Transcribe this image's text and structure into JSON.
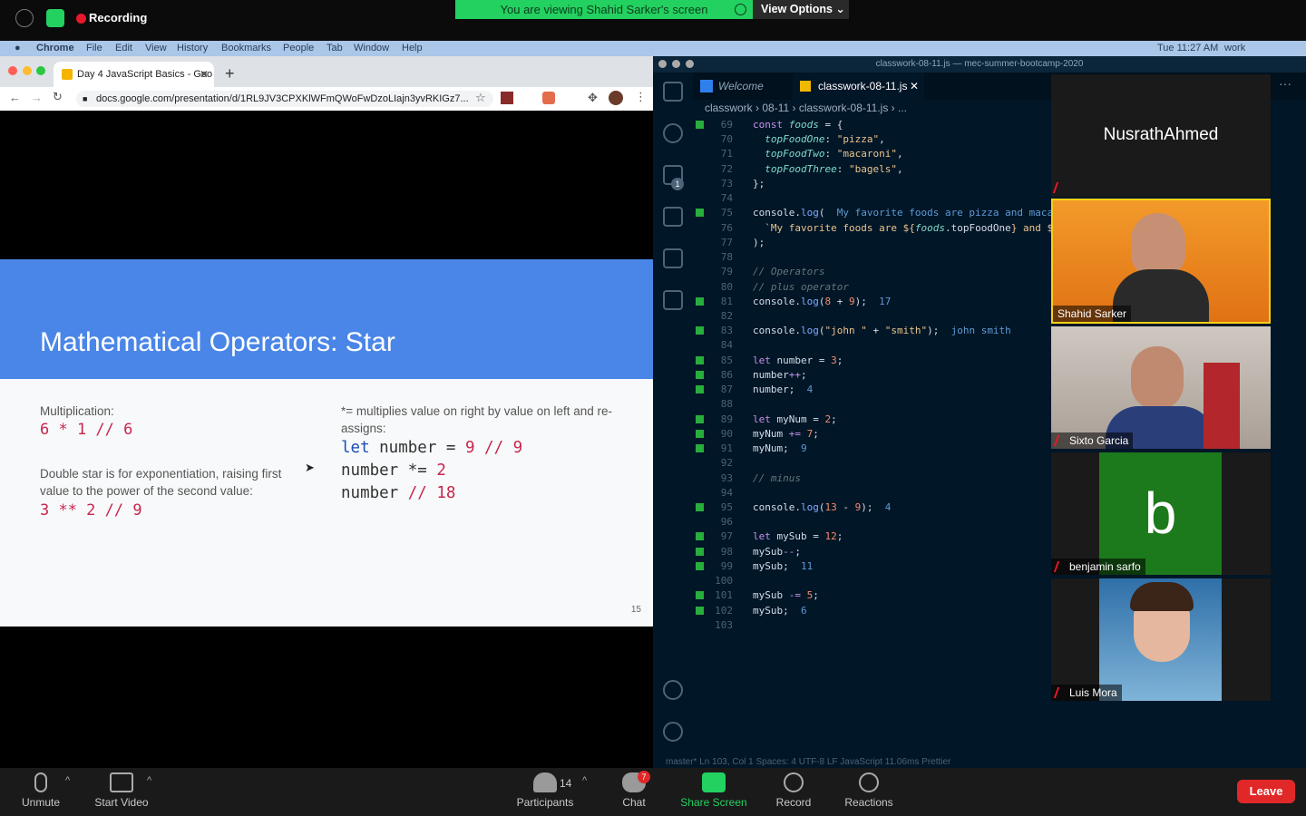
{
  "zoom_top": {
    "recording_label": "Recording",
    "banner": "You are viewing Shahid Sarker's screen",
    "view_options": "View Options"
  },
  "mac_menu": {
    "app": "Chrome",
    "items": [
      "File",
      "Edit",
      "View",
      "History",
      "Bookmarks",
      "People",
      "Tab",
      "Window",
      "Help"
    ],
    "clock": "Tue 11:27 AM",
    "user": "work"
  },
  "chrome": {
    "tab_title": "Day 4 JavaScript Basics - Goo",
    "url": "docs.google.com/presentation/d/1RL9JV3CPXKlWFmQWoFwDzoLIajn3yvRKIGz7..."
  },
  "slide": {
    "title": "Mathematical Operators: Star",
    "left_label": "Multiplication:",
    "left_code": "6 * 1 // 6",
    "left_label2": "Double star is for exponentiation, raising first value to the power of the second value:",
    "left_code2": "3 ** 2 // 9",
    "right_label": "*= multiplies value on right by value on left and re-assigns:",
    "right_code": [
      "let number = 9 // 9",
      "number *= 2",
      "number // 18"
    ],
    "page_number": "15"
  },
  "vscode": {
    "window_title": "classwork-08-11.js — mec-summer-bootcamp-2020",
    "tab_welcome": "Welcome",
    "tab_file": "classwork-08-11.js",
    "breadcrumb": [
      "classwork",
      "08-11",
      "classwork-08-11.js",
      "..."
    ],
    "status": "master*   Ln 103, Col 1   Spaces: 4   UTF-8   LF   JavaScript   11.06ms   Prettier",
    "lines": [
      {
        "n": "69",
        "m": true,
        "html": "<span class='c-kw'>const</span> <span class='c-prop'>foods</span> = {"
      },
      {
        "n": "70",
        "m": false,
        "html": "  <span class='c-prop'>topFoodOne</span>: <span class='c-str'>\"pizza\"</span>,"
      },
      {
        "n": "71",
        "m": false,
        "html": "  <span class='c-prop'>topFoodTwo</span>: <span class='c-str'>\"macaroni\"</span>,"
      },
      {
        "n": "72",
        "m": false,
        "html": "  <span class='c-prop'>topFoodThree</span>: <span class='c-str'>\"bagels\"</span>,"
      },
      {
        "n": "73",
        "m": false,
        "html": "};"
      },
      {
        "n": "74",
        "m": false,
        "html": ""
      },
      {
        "n": "75",
        "m": true,
        "html": "console.<span class='c-fn'>log</span>(  <span class='c-out'>My favorite foods are pizza and macaroni</span>"
      },
      {
        "n": "76",
        "m": false,
        "html": "  <span class='c-str'>`My favorite foods are ${</span><span class='c-prop'>foods</span>.topFoodOne<span class='c-str'>} and ${f</span>"
      },
      {
        "n": "77",
        "m": false,
        "html": ");"
      },
      {
        "n": "78",
        "m": false,
        "html": ""
      },
      {
        "n": "79",
        "m": false,
        "html": "<span class='c-cm'>// Operators</span>"
      },
      {
        "n": "80",
        "m": false,
        "html": "<span class='c-cm'>// plus operator</span>"
      },
      {
        "n": "81",
        "m": true,
        "html": "console.<span class='c-fn'>log</span>(<span class='c-num'>8</span> + <span class='c-num'>9</span>);  <span class='c-out'>17</span>"
      },
      {
        "n": "82",
        "m": false,
        "html": ""
      },
      {
        "n": "83",
        "m": true,
        "html": "console.<span class='c-fn'>log</span>(<span class='c-str'>\"john \"</span> + <span class='c-str'>\"smith\"</span>);  <span class='c-out'>john smith</span>"
      },
      {
        "n": "84",
        "m": false,
        "html": ""
      },
      {
        "n": "85",
        "m": true,
        "html": "<span class='c-kw'>let</span> number = <span class='c-num'>3</span>;"
      },
      {
        "n": "86",
        "m": true,
        "html": "number<span class='c-kw'>++</span>;"
      },
      {
        "n": "87",
        "m": true,
        "html": "number;  <span class='c-out'>4</span>"
      },
      {
        "n": "88",
        "m": false,
        "html": ""
      },
      {
        "n": "89",
        "m": true,
        "html": "<span class='c-kw'>let</span> myNum = <span class='c-num'>2</span>;"
      },
      {
        "n": "90",
        "m": true,
        "html": "myNum <span class='c-kw'>+=</span> <span class='c-num'>7</span>;"
      },
      {
        "n": "91",
        "m": true,
        "html": "myNum;  <span class='c-out'>9</span>"
      },
      {
        "n": "92",
        "m": false,
        "html": ""
      },
      {
        "n": "93",
        "m": false,
        "html": "<span class='c-cm'>// minus</span>"
      },
      {
        "n": "94",
        "m": false,
        "html": ""
      },
      {
        "n": "95",
        "m": true,
        "html": "console.<span class='c-fn'>log</span>(<span class='c-num'>13</span> - <span class='c-num'>9</span>);  <span class='c-out'>4</span>"
      },
      {
        "n": "96",
        "m": false,
        "html": ""
      },
      {
        "n": "97",
        "m": true,
        "html": "<span class='c-kw'>let</span> mySub = <span class='c-num'>12</span>;"
      },
      {
        "n": "98",
        "m": true,
        "html": "mySub<span class='c-kw'>--</span>;"
      },
      {
        "n": "99",
        "m": true,
        "html": "mySub;  <span class='c-out'>11</span>"
      },
      {
        "n": "100",
        "m": false,
        "html": ""
      },
      {
        "n": "101",
        "m": true,
        "html": "mySub <span class='c-kw'>-=</span> <span class='c-num'>5</span>;"
      },
      {
        "n": "102",
        "m": true,
        "html": "mySub;  <span class='c-out'>6</span>"
      },
      {
        "n": "103",
        "m": false,
        "html": ""
      }
    ]
  },
  "participants": [
    {
      "name": "NusrathAhmed",
      "muted": true,
      "kind": "name-only"
    },
    {
      "name": "Shahid Sarker",
      "muted": false,
      "kind": "video-orange"
    },
    {
      "name": "Sixto Garcia",
      "muted": true,
      "kind": "video-room"
    },
    {
      "name": "benjamin sarfo",
      "muted": true,
      "kind": "avatar",
      "initial": "b"
    },
    {
      "name": "Luis Mora",
      "muted": true,
      "kind": "photo"
    }
  ],
  "zoom_bottom": {
    "unmute": "Unmute",
    "start_video": "Start Video",
    "participants_label": "Participants",
    "participants_count": "14",
    "chat_label": "Chat",
    "chat_badge": "7",
    "share_screen": "Share Screen",
    "record": "Record",
    "reactions": "Reactions",
    "leave": "Leave"
  },
  "colors": {
    "zoom_green": "#23d160",
    "slide_blue": "#4a86e8",
    "leave_red": "#e02828"
  }
}
